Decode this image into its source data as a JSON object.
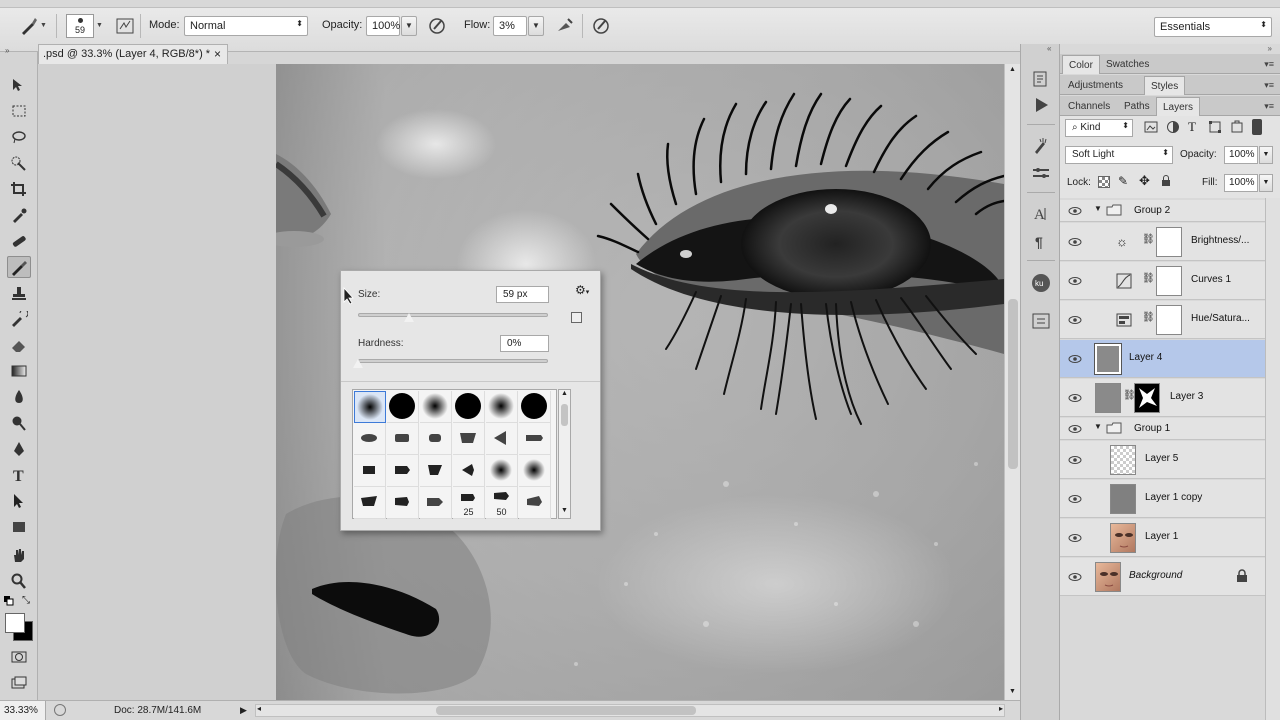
{
  "options_bar": {
    "brush_size": "59",
    "mode_label": "Mode:",
    "mode_value": "Normal",
    "opacity_label": "Opacity:",
    "opacity_value": "100%",
    "flow_label": "Flow:",
    "flow_value": "3%",
    "workspace_value": "Essentials"
  },
  "document": {
    "tab_title": ".psd @ 33.3% (Layer 4, RGB/8*) *",
    "close_glyph": "×"
  },
  "status_bar": {
    "zoom": "33.33%",
    "doc_info": "Doc: 28.7M/141.6M"
  },
  "brush_popup": {
    "size_label": "Size:",
    "size_value": "59 px",
    "size_fraction": 0.27,
    "hardness_label": "Hardness:",
    "hardness_value": "0%",
    "hardness_fraction": 0.0,
    "brush_numbers": [
      "25",
      "50"
    ]
  },
  "panels": {
    "top_tabs": [
      "Color",
      "Swatches"
    ],
    "mid_tabs": [
      "Adjustments",
      "Styles"
    ],
    "layer_tabs": [
      "Channels",
      "Paths",
      "Layers"
    ],
    "filter_kind": "Kind",
    "blend_mode": "Soft Light",
    "opacity_label": "Opacity:",
    "opacity_value": "100%",
    "lock_label": "Lock:",
    "fill_label": "Fill:",
    "fill_value": "100%"
  },
  "layers": [
    {
      "name": "Group 2",
      "kind": "group"
    },
    {
      "name": "Brightness/...",
      "kind": "adjustment",
      "icon": "brightness-icon"
    },
    {
      "name": "Curves 1",
      "kind": "adjustment",
      "icon": "curves-icon"
    },
    {
      "name": "Hue/Satura...",
      "kind": "adjustment",
      "icon": "hue-saturation-icon"
    },
    {
      "name": "Layer 4",
      "kind": "layer",
      "selected": true
    },
    {
      "name": "Layer 3",
      "kind": "masked"
    },
    {
      "name": "Group 1",
      "kind": "group"
    },
    {
      "name": "Layer 5",
      "kind": "layer"
    },
    {
      "name": "Layer 1 copy",
      "kind": "layer"
    },
    {
      "name": "Layer 1",
      "kind": "layer"
    },
    {
      "name": "Background",
      "kind": "background",
      "locked": true
    }
  ],
  "colors": {
    "selected_layer": "#b5c8ea",
    "panel_bg": "#d9d9d9"
  }
}
